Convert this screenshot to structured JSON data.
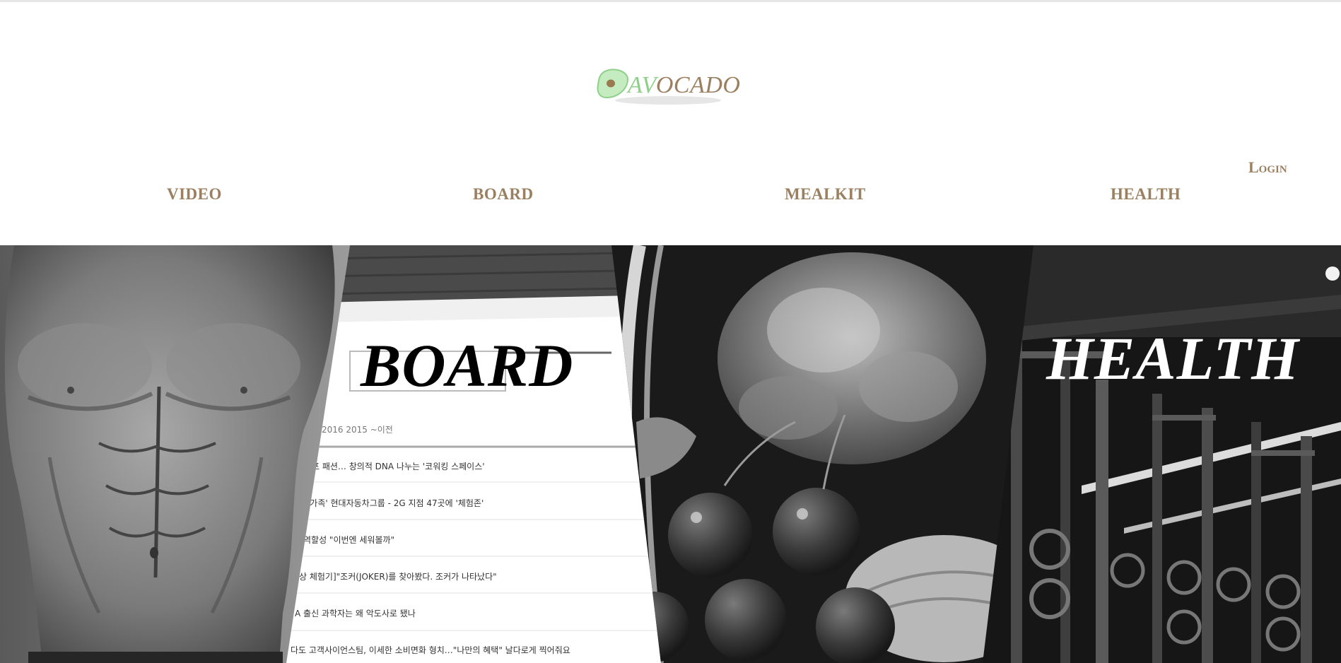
{
  "header": {
    "logo": {
      "text_prefix": "AV",
      "text_rest": "OCADO"
    },
    "login_label": "Login"
  },
  "nav": {
    "items": [
      {
        "label": "VIDEO"
      },
      {
        "label": "BOARD"
      },
      {
        "label": "MEALKIT"
      },
      {
        "label": "HEALTH"
      }
    ]
  },
  "hero": {
    "board": {
      "title": "BOARD",
      "years": "2016    2015    ~이전",
      "rows": [
        "프 패션… 창의적 DNA 나누는 '코워킹 스페이스'",
        "'가족' 현대자동차그룹 - 2G 지점 47곳에 '체험존'",
        "역할성 \"이번엔 세워볼까\"",
        "상 체험기]\"조커(JOKER)를 찾아봤다. 조커가 나타났다\"",
        "A 출신 과학자는 왜 악도사로 됐나",
        "다도 고객사이언스팀, 이세한 소비면화 형치…\"나만의 혜택\" 날다로게 찍어줘요"
      ]
    },
    "health": {
      "title": "HEALTH"
    }
  },
  "colors": {
    "brand_brown": "#9a8060",
    "brand_green": "#8ed08a",
    "avocado_light": "#c4ecc0",
    "avocado_pit": "#9a7a50"
  }
}
